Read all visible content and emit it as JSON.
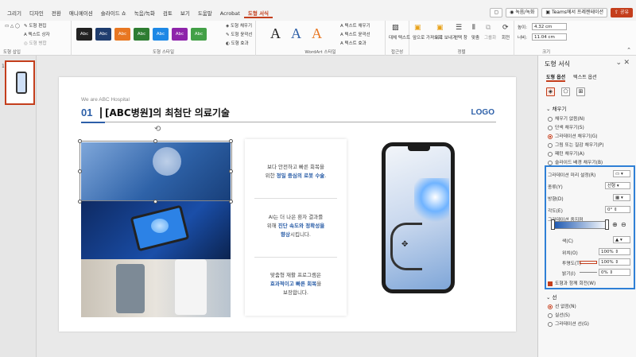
{
  "menubar": {
    "tabs": [
      "그리기",
      "디자인",
      "전환",
      "애니메이션",
      "슬라이드 쇼",
      "녹음/녹화",
      "검토",
      "보기",
      "도움말",
      "Acrobat",
      "도형 서식"
    ],
    "active_tab": "도형 서식",
    "record_label": "녹음/녹화",
    "teams_label": "Teams에서 프레젠테이션",
    "share_label": "공유"
  },
  "ribbon": {
    "insert_shape": {
      "label": "도형 삽입",
      "edit": "도형 편집",
      "textbox": "텍스트 상자",
      "merge": "도형 병합"
    },
    "shape_styles": {
      "label": "도형 스타일",
      "swatch_text": "Abc",
      "fill": "도형 채우기",
      "outline": "도형 윤곽선",
      "effects": "도형 효과",
      "swatches": [
        "#222222",
        "#1f3d6e",
        "#e87722",
        "#2e7d32",
        "#1e88e5",
        "#8e24aa",
        "#43a047"
      ]
    },
    "wordart": {
      "label": "WordArt 스타일",
      "letter": "A",
      "fill": "텍스트 채우기",
      "outline": "텍스트 윤곽선",
      "effects": "텍스트 효과"
    },
    "accessibility": {
      "label": "접근성",
      "alt": "대체 텍스트"
    },
    "arrange": {
      "label": "정렬",
      "forward": "앞으로 가져오기",
      "backward": "뒤로 보내기",
      "pane": "선택 창",
      "align": "맞춤",
      "group": "그룹화",
      "rotate": "회전"
    },
    "size": {
      "label": "크기",
      "height_label": "높이:",
      "height": "4.32 cm",
      "width_label": "너비:",
      "width": "11.04 cm"
    }
  },
  "thumbs": {
    "number": "1"
  },
  "slide": {
    "eyebrow": "We are ABC Hospital",
    "number": "01",
    "title": "[ABC병원]의 최첨단 의료기술",
    "logo": "LOGO",
    "paragraphs": [
      {
        "line1": "보다 안전하고 빠른 회복을",
        "line2_pre": "위한 ",
        "line2_bold": "정밀 중심의 로봇 수술",
        "line2_post": "."
      },
      {
        "line1": "AI는 더 나은 환자 결과를",
        "line2_pre": "위해 ",
        "line2_bold": "진단 속도와 정확성을",
        "line3_bold": "향상",
        "line3_post": "시킵니다."
      },
      {
        "line1": "맞춤형 재활 프로그램은",
        "line2_bold": "효과적이고 빠른 회복",
        "line2_post": "을",
        "line3_post": "보장합니다."
      }
    ]
  },
  "pane": {
    "title": "도형 서식",
    "tabs": [
      "도형 옵션",
      "텍스트 옵션"
    ],
    "fill_section": "채우기",
    "fill_options": [
      "채우기 없음(N)",
      "단색 채우기(S)",
      "그라데이션 채우기(G)",
      "그림 또는 질감 채우기(P)",
      "패턴 채우기(A)",
      "슬라이드 배경 채우기(B)"
    ],
    "fill_selected": 2,
    "preset_label": "그라데이션 미리 설정(R)",
    "type_label": "종류(Y)",
    "type_value": "선형",
    "direction_label": "방향(D)",
    "angle_label": "각도(E)",
    "angle_value": "0°",
    "stops_label": "그라데이션 중지점",
    "color_label": "색(C)",
    "position_label": "위치(O)",
    "position_value": "100%",
    "transparency_label": "투명도(T)",
    "transparency_value": "100%",
    "brightness_label": "밝기(I)",
    "brightness_value": "0%",
    "rotate_with_shape": "도형과 함께 회전(W)",
    "line_section": "선",
    "line_options": [
      "선 없음(N)",
      "실선(S)",
      "그라데이션 선(G)"
    ],
    "line_selected": 0
  }
}
